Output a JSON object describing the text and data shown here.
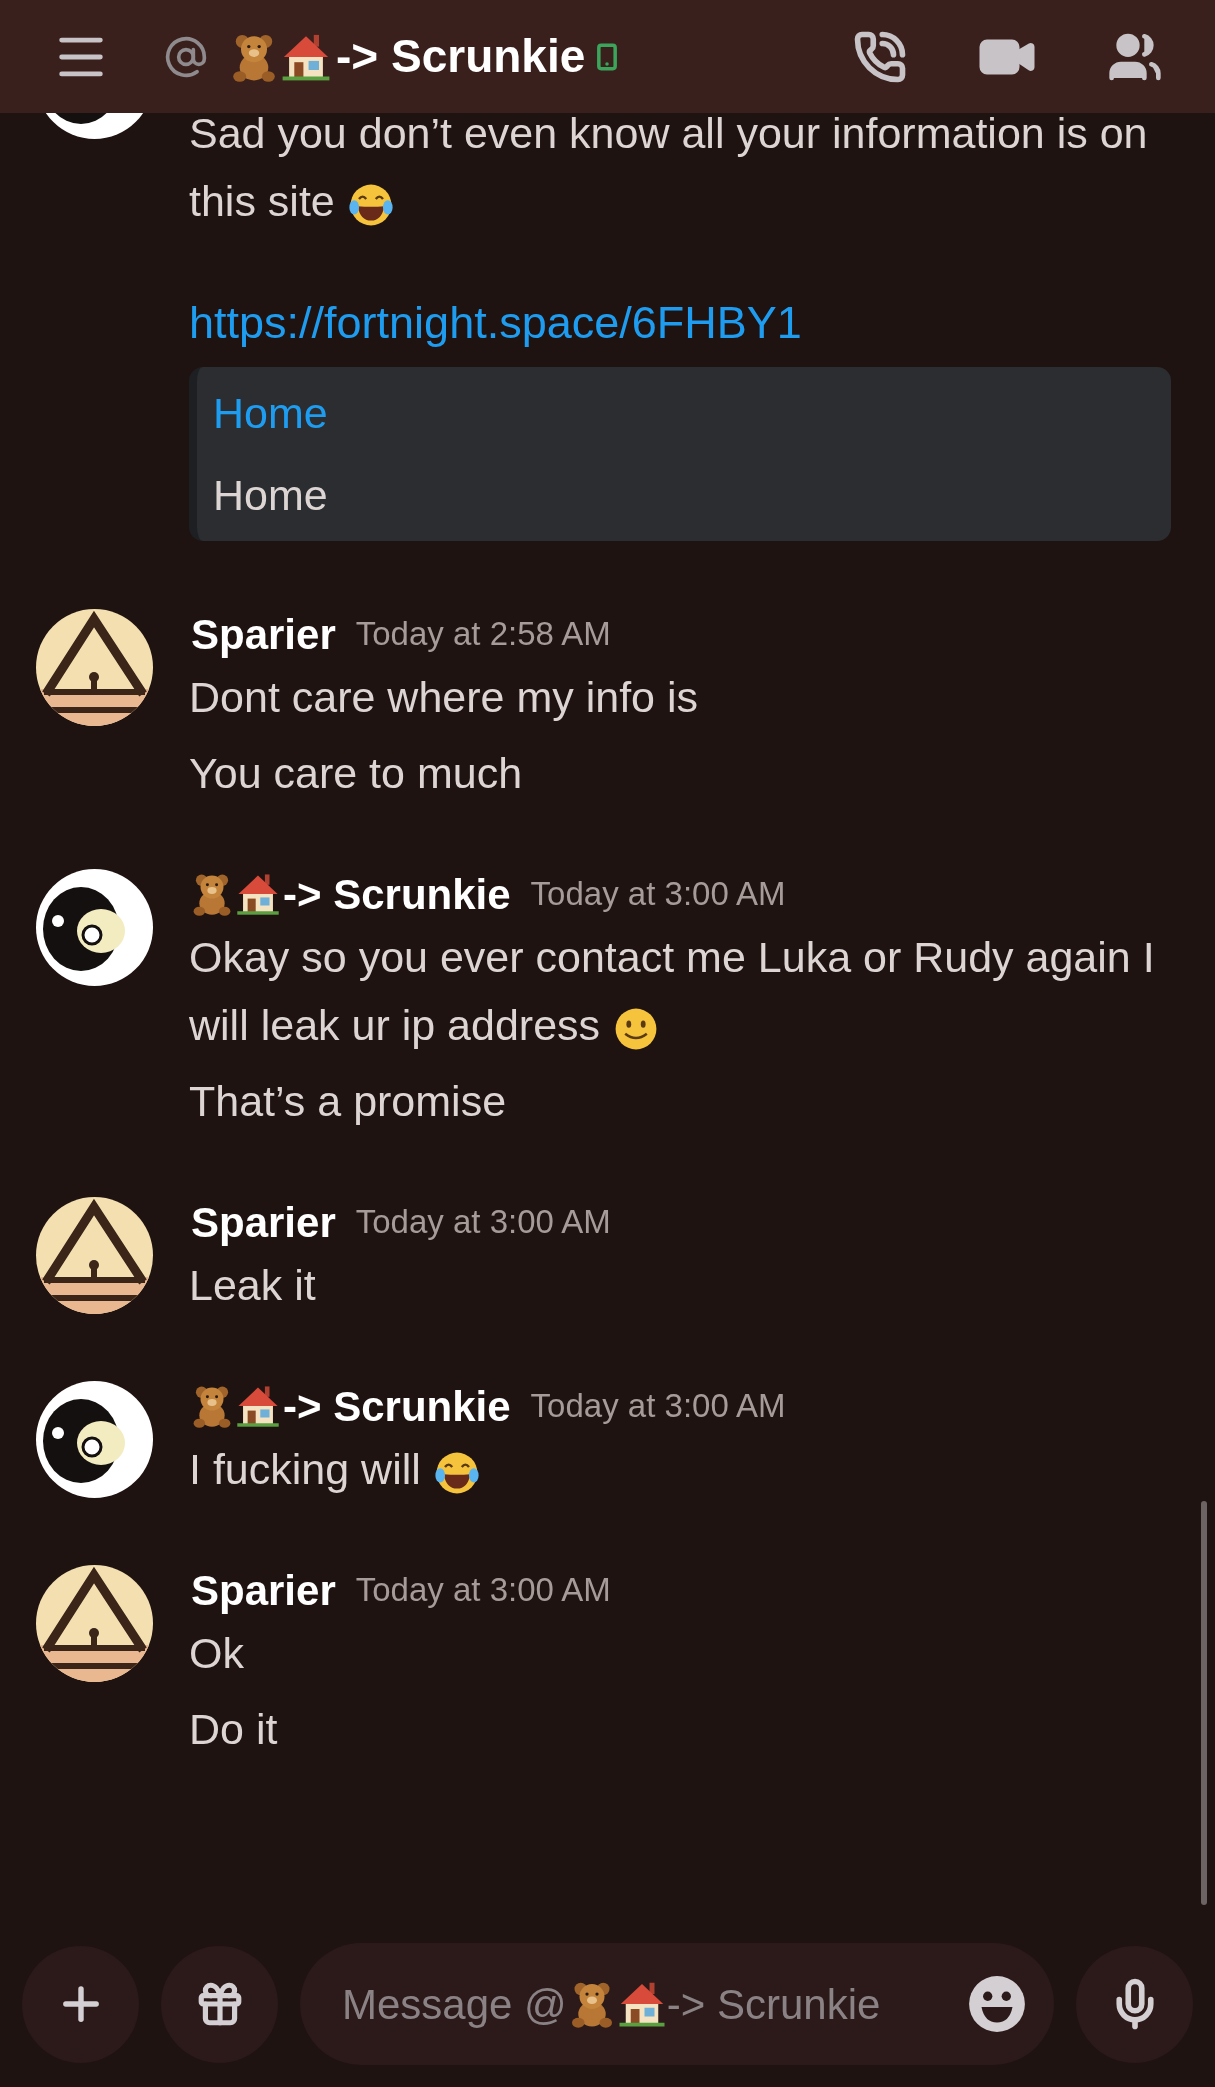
{
  "header": {
    "title_emoji": [
      {
        "kind": "bear"
      },
      {
        "kind": "house"
      }
    ],
    "title": "-> Scrunkie"
  },
  "messages": [
    {
      "avatar": {
        "kind": "creature"
      },
      "lines": [
        {
          "text": "Sad you don’t even know all your information is on this site",
          "emoji": {
            "kind": "laughing"
          }
        }
      ],
      "link": "https://fortnight.space/6FHBY1",
      "embed": {
        "title": "Home",
        "description": "Home"
      }
    },
    {
      "avatar": {
        "kind": "tower"
      },
      "author": "Sparier",
      "time": "Today at 2:58 AM",
      "lines": [
        {
          "text": "Dont care where my info is"
        },
        {
          "text": "You care to much"
        }
      ]
    },
    {
      "avatar": {
        "kind": "creature"
      },
      "name_emoji": [
        {
          "kind": "bear"
        },
        {
          "kind": "house"
        }
      ],
      "author": "-> Scrunkie",
      "time": "Today at 3:00 AM",
      "lines": [
        {
          "text": "Okay so you ever contact me Luka or Rudy again I will leak ur ip address",
          "emoji": {
            "kind": "smiling"
          }
        },
        {
          "text": "That’s a promise"
        }
      ]
    },
    {
      "avatar": {
        "kind": "tower"
      },
      "author": "Sparier",
      "time": "Today at 3:00 AM",
      "lines": [
        {
          "text": "Leak it"
        }
      ]
    },
    {
      "avatar": {
        "kind": "creature"
      },
      "name_emoji": [
        {
          "kind": "bear"
        },
        {
          "kind": "house"
        }
      ],
      "author": "-> Scrunkie",
      "time": "Today at 3:00 AM",
      "lines": [
        {
          "text": "I fucking will",
          "emoji": {
            "kind": "laughing"
          }
        }
      ]
    },
    {
      "avatar": {
        "kind": "tower"
      },
      "author": "Sparier",
      "time": "Today at 3:00 AM",
      "lines": [
        {
          "text": "Ok"
        },
        {
          "text": "Do it"
        }
      ]
    }
  ],
  "composer": {
    "placeholder_start": "Message @",
    "placeholder_emoji": [
      {
        "kind": "bear"
      },
      {
        "kind": "house"
      }
    ],
    "placeholder_end": "-> Scrunkie"
  }
}
